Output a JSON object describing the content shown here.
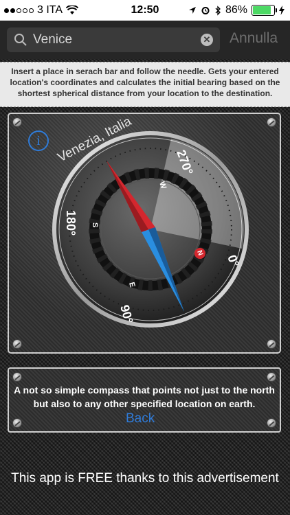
{
  "status_bar": {
    "carrier": "3 ITA",
    "time": "12:50",
    "battery_percent": "86%",
    "battery_level": 0.86,
    "signal_bars": 2
  },
  "search": {
    "value": "Venice",
    "placeholder": "",
    "cancel_label": "Annulla"
  },
  "instructions": {
    "text": "Insert a place in serach bar and follow the needle. Gets your entered location's coordinates and calculates the initial bearing based on the shortest spherical distance from your location to the destination."
  },
  "compass": {
    "location_label": "Venezia, Italia",
    "degree_labels": [
      "270°",
      "180°",
      "90°",
      "0°"
    ],
    "cardinal_labels": [
      "W",
      "S",
      "E",
      "N"
    ],
    "colors": {
      "needle_red": "#d4272e",
      "needle_blue": "#2a8ee0",
      "accent": "#2f7bd8"
    }
  },
  "about": {
    "text": "A not so simple compass that points not just to the north but also to any other specified location on earth.",
    "back_label": "Back"
  },
  "ad": {
    "text": "This app is FREE thanks to this advertisement"
  }
}
